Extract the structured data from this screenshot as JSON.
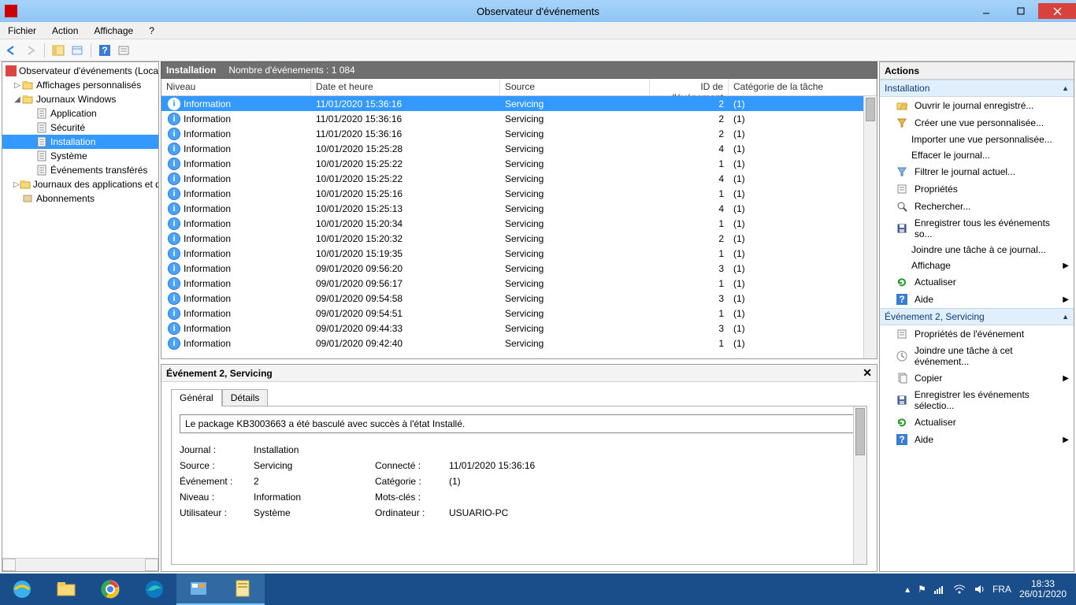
{
  "window": {
    "title": "Observateur d'événements"
  },
  "menus": [
    "Fichier",
    "Action",
    "Affichage",
    "?"
  ],
  "tree": {
    "root": "Observateur d'événements (Local)",
    "items": [
      {
        "label": "Affichages personnalisés",
        "depth": 1,
        "exp": "▷"
      },
      {
        "label": "Journaux Windows",
        "depth": 1,
        "exp": "◢"
      },
      {
        "label": "Application",
        "depth": 2
      },
      {
        "label": "Sécurité",
        "depth": 2
      },
      {
        "label": "Installation",
        "depth": 2,
        "selected": true
      },
      {
        "label": "Système",
        "depth": 2
      },
      {
        "label": "Événements transférés",
        "depth": 2
      },
      {
        "label": "Journaux des applications et des services",
        "depth": 1,
        "exp": "▷"
      },
      {
        "label": "Abonnements",
        "depth": 1
      }
    ]
  },
  "section": {
    "title": "Installation",
    "count_label": "Nombre d'événements : 1 084"
  },
  "columns": {
    "level": "Niveau",
    "date": "Date et heure",
    "source": "Source",
    "id": "ID de l'événement",
    "cat": "Catégorie de la tâche"
  },
  "events": [
    {
      "level": "Information",
      "date": "11/01/2020 15:36:16",
      "source": "Servicing",
      "id": "2",
      "cat": "(1)",
      "sel": true
    },
    {
      "level": "Information",
      "date": "11/01/2020 15:36:16",
      "source": "Servicing",
      "id": "2",
      "cat": "(1)"
    },
    {
      "level": "Information",
      "date": "11/01/2020 15:36:16",
      "source": "Servicing",
      "id": "2",
      "cat": "(1)"
    },
    {
      "level": "Information",
      "date": "10/01/2020 15:25:28",
      "source": "Servicing",
      "id": "4",
      "cat": "(1)"
    },
    {
      "level": "Information",
      "date": "10/01/2020 15:25:22",
      "source": "Servicing",
      "id": "1",
      "cat": "(1)"
    },
    {
      "level": "Information",
      "date": "10/01/2020 15:25:22",
      "source": "Servicing",
      "id": "4",
      "cat": "(1)"
    },
    {
      "level": "Information",
      "date": "10/01/2020 15:25:16",
      "source": "Servicing",
      "id": "1",
      "cat": "(1)"
    },
    {
      "level": "Information",
      "date": "10/01/2020 15:25:13",
      "source": "Servicing",
      "id": "4",
      "cat": "(1)"
    },
    {
      "level": "Information",
      "date": "10/01/2020 15:20:34",
      "source": "Servicing",
      "id": "1",
      "cat": "(1)"
    },
    {
      "level": "Information",
      "date": "10/01/2020 15:20:32",
      "source": "Servicing",
      "id": "2",
      "cat": "(1)"
    },
    {
      "level": "Information",
      "date": "10/01/2020 15:19:35",
      "source": "Servicing",
      "id": "1",
      "cat": "(1)"
    },
    {
      "level": "Information",
      "date": "09/01/2020 09:56:20",
      "source": "Servicing",
      "id": "3",
      "cat": "(1)"
    },
    {
      "level": "Information",
      "date": "09/01/2020 09:56:17",
      "source": "Servicing",
      "id": "1",
      "cat": "(1)"
    },
    {
      "level": "Information",
      "date": "09/01/2020 09:54:58",
      "source": "Servicing",
      "id": "3",
      "cat": "(1)"
    },
    {
      "level": "Information",
      "date": "09/01/2020 09:54:51",
      "source": "Servicing",
      "id": "1",
      "cat": "(1)"
    },
    {
      "level": "Information",
      "date": "09/01/2020 09:44:33",
      "source": "Servicing",
      "id": "3",
      "cat": "(1)"
    },
    {
      "level": "Information",
      "date": "09/01/2020 09:42:40",
      "source": "Servicing",
      "id": "1",
      "cat": "(1)"
    }
  ],
  "detail": {
    "title": "Événement 2, Servicing",
    "tabs": {
      "general": "Général",
      "details": "Détails"
    },
    "message": "Le package KB3003663 a été basculé avec succès à l'état Installé.",
    "labels": {
      "journal": "Journal :",
      "source": "Source :",
      "event": "Événement :",
      "level": "Niveau :",
      "user": "Utilisateur :",
      "logged": "Connecté :",
      "category": "Catégorie :",
      "keywords": "Mots-clés :",
      "computer": "Ordinateur :"
    },
    "values": {
      "journal": "Installation",
      "source": "Servicing",
      "event": "2",
      "level": "Information",
      "user": "Système",
      "logged": "11/01/2020 15:36:16",
      "category": "(1)",
      "keywords": "",
      "computer": "USUARIO-PC"
    }
  },
  "actions": {
    "header": "Actions",
    "group1": "Installation",
    "group1_items": [
      {
        "label": "Ouvrir le journal enregistré...",
        "icon": "open"
      },
      {
        "label": "Créer une vue personnalisée...",
        "icon": "funnel"
      },
      {
        "label": "Importer une vue personnalisée...",
        "indent": true
      },
      {
        "label": "Effacer le journal...",
        "indent": true
      },
      {
        "label": "Filtrer le journal actuel...",
        "icon": "filter"
      },
      {
        "label": "Propriétés",
        "icon": "props"
      },
      {
        "label": "Rechercher...",
        "icon": "find"
      },
      {
        "label": "Enregistrer tous les événements so...",
        "icon": "save"
      },
      {
        "label": "Joindre une tâche à ce journal...",
        "indent": true
      },
      {
        "label": "Affichage",
        "arrow": true,
        "indent": true
      },
      {
        "label": "Actualiser",
        "icon": "refresh"
      },
      {
        "label": "Aide",
        "icon": "help",
        "arrow": true
      }
    ],
    "group2": "Événement 2, Servicing",
    "group2_items": [
      {
        "label": "Propriétés de l'événement",
        "icon": "props"
      },
      {
        "label": "Joindre une tâche à cet événement...",
        "icon": "task"
      },
      {
        "label": "Copier",
        "icon": "copy",
        "arrow": true
      },
      {
        "label": "Enregistrer les événements sélectio...",
        "icon": "save"
      },
      {
        "label": "Actualiser",
        "icon": "refresh"
      },
      {
        "label": "Aide",
        "icon": "help",
        "arrow": true
      }
    ]
  },
  "taskbar": {
    "lang": "FRA",
    "time": "18:33",
    "date": "26/01/2020"
  }
}
